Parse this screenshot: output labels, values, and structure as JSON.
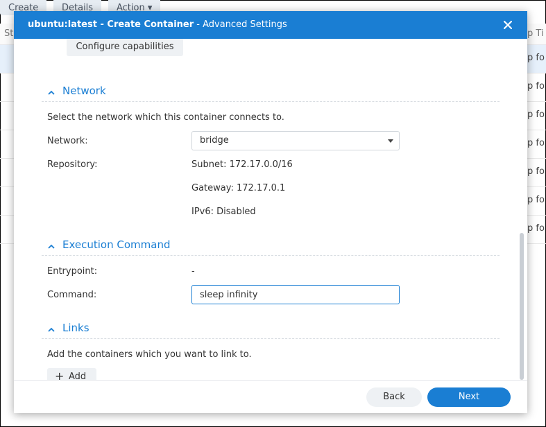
{
  "background": {
    "toolbar": {
      "create": "Create",
      "details": "Details",
      "action": "Action ▾"
    },
    "table": {
      "header_left": "St",
      "header_right": "p Ti",
      "rows": [
        "p fo",
        "p fo",
        "p fo",
        "p fo",
        "p fo",
        "p fo",
        "p fo"
      ]
    }
  },
  "modal": {
    "title_bold": "ubuntu:latest - Create Container",
    "title_rest": " - Advanced Settings",
    "close_icon": "close-icon"
  },
  "content": {
    "configure_capabilities_label": "Configure capabilities",
    "network": {
      "title": "Network",
      "description": "Select the network which this container connects to.",
      "network_label": "Network:",
      "network_value": "bridge",
      "repository_label": "Repository:",
      "subnet": "Subnet: 172.17.0.0/16",
      "gateway": "Gateway: 172.17.0.1",
      "ipv6": "IPv6: Disabled"
    },
    "execution": {
      "title": "Execution Command",
      "entrypoint_label": "Entrypoint:",
      "entrypoint_value": "-",
      "command_label": "Command:",
      "command_value": "sleep infinity"
    },
    "links": {
      "title": "Links",
      "description": "Add the containers which you want to link to.",
      "add_label": "Add"
    }
  },
  "footer": {
    "back_label": "Back",
    "next_label": "Next"
  },
  "colors": {
    "accent": "#1a7ed3"
  }
}
